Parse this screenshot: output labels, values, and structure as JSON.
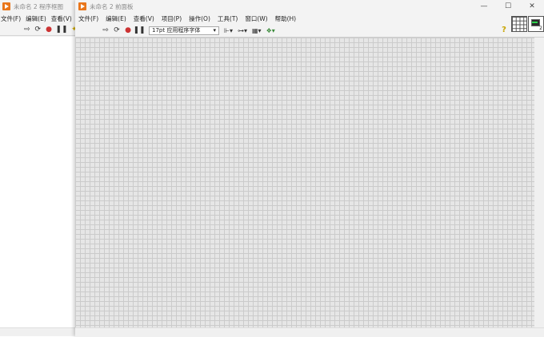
{
  "back_window": {
    "title": "未命名 2 程序框图",
    "menu": [
      "文件(F)",
      "编辑(E)",
      "查看(V)"
    ],
    "toolbar_icons": [
      "run-arrow-icon",
      "run-continuous-icon",
      "abort-icon",
      "pause-icon",
      "highlight-icon"
    ]
  },
  "front_window": {
    "title": "未命名 2 前面板",
    "controls": {
      "minimize": "—",
      "maximize": "☐",
      "close": "✕"
    },
    "menu": [
      "文件(F)",
      "编辑(E)",
      "查看(V)",
      "项目(P)",
      "操作(O)",
      "工具(T)",
      "窗口(W)",
      "帮助(H)"
    ],
    "toolbar": {
      "font_select": "17pt 应用程序字体",
      "buttons": [
        "align-objects-icon",
        "distribute-objects-icon",
        "resize-objects-icon",
        "reorder-icon"
      ],
      "help": "?"
    },
    "vi_icon_number": "2"
  },
  "colors": {
    "logo": "#e9761b",
    "panel_bg": "#e6e6e6",
    "grid": "#cbcbcb"
  }
}
